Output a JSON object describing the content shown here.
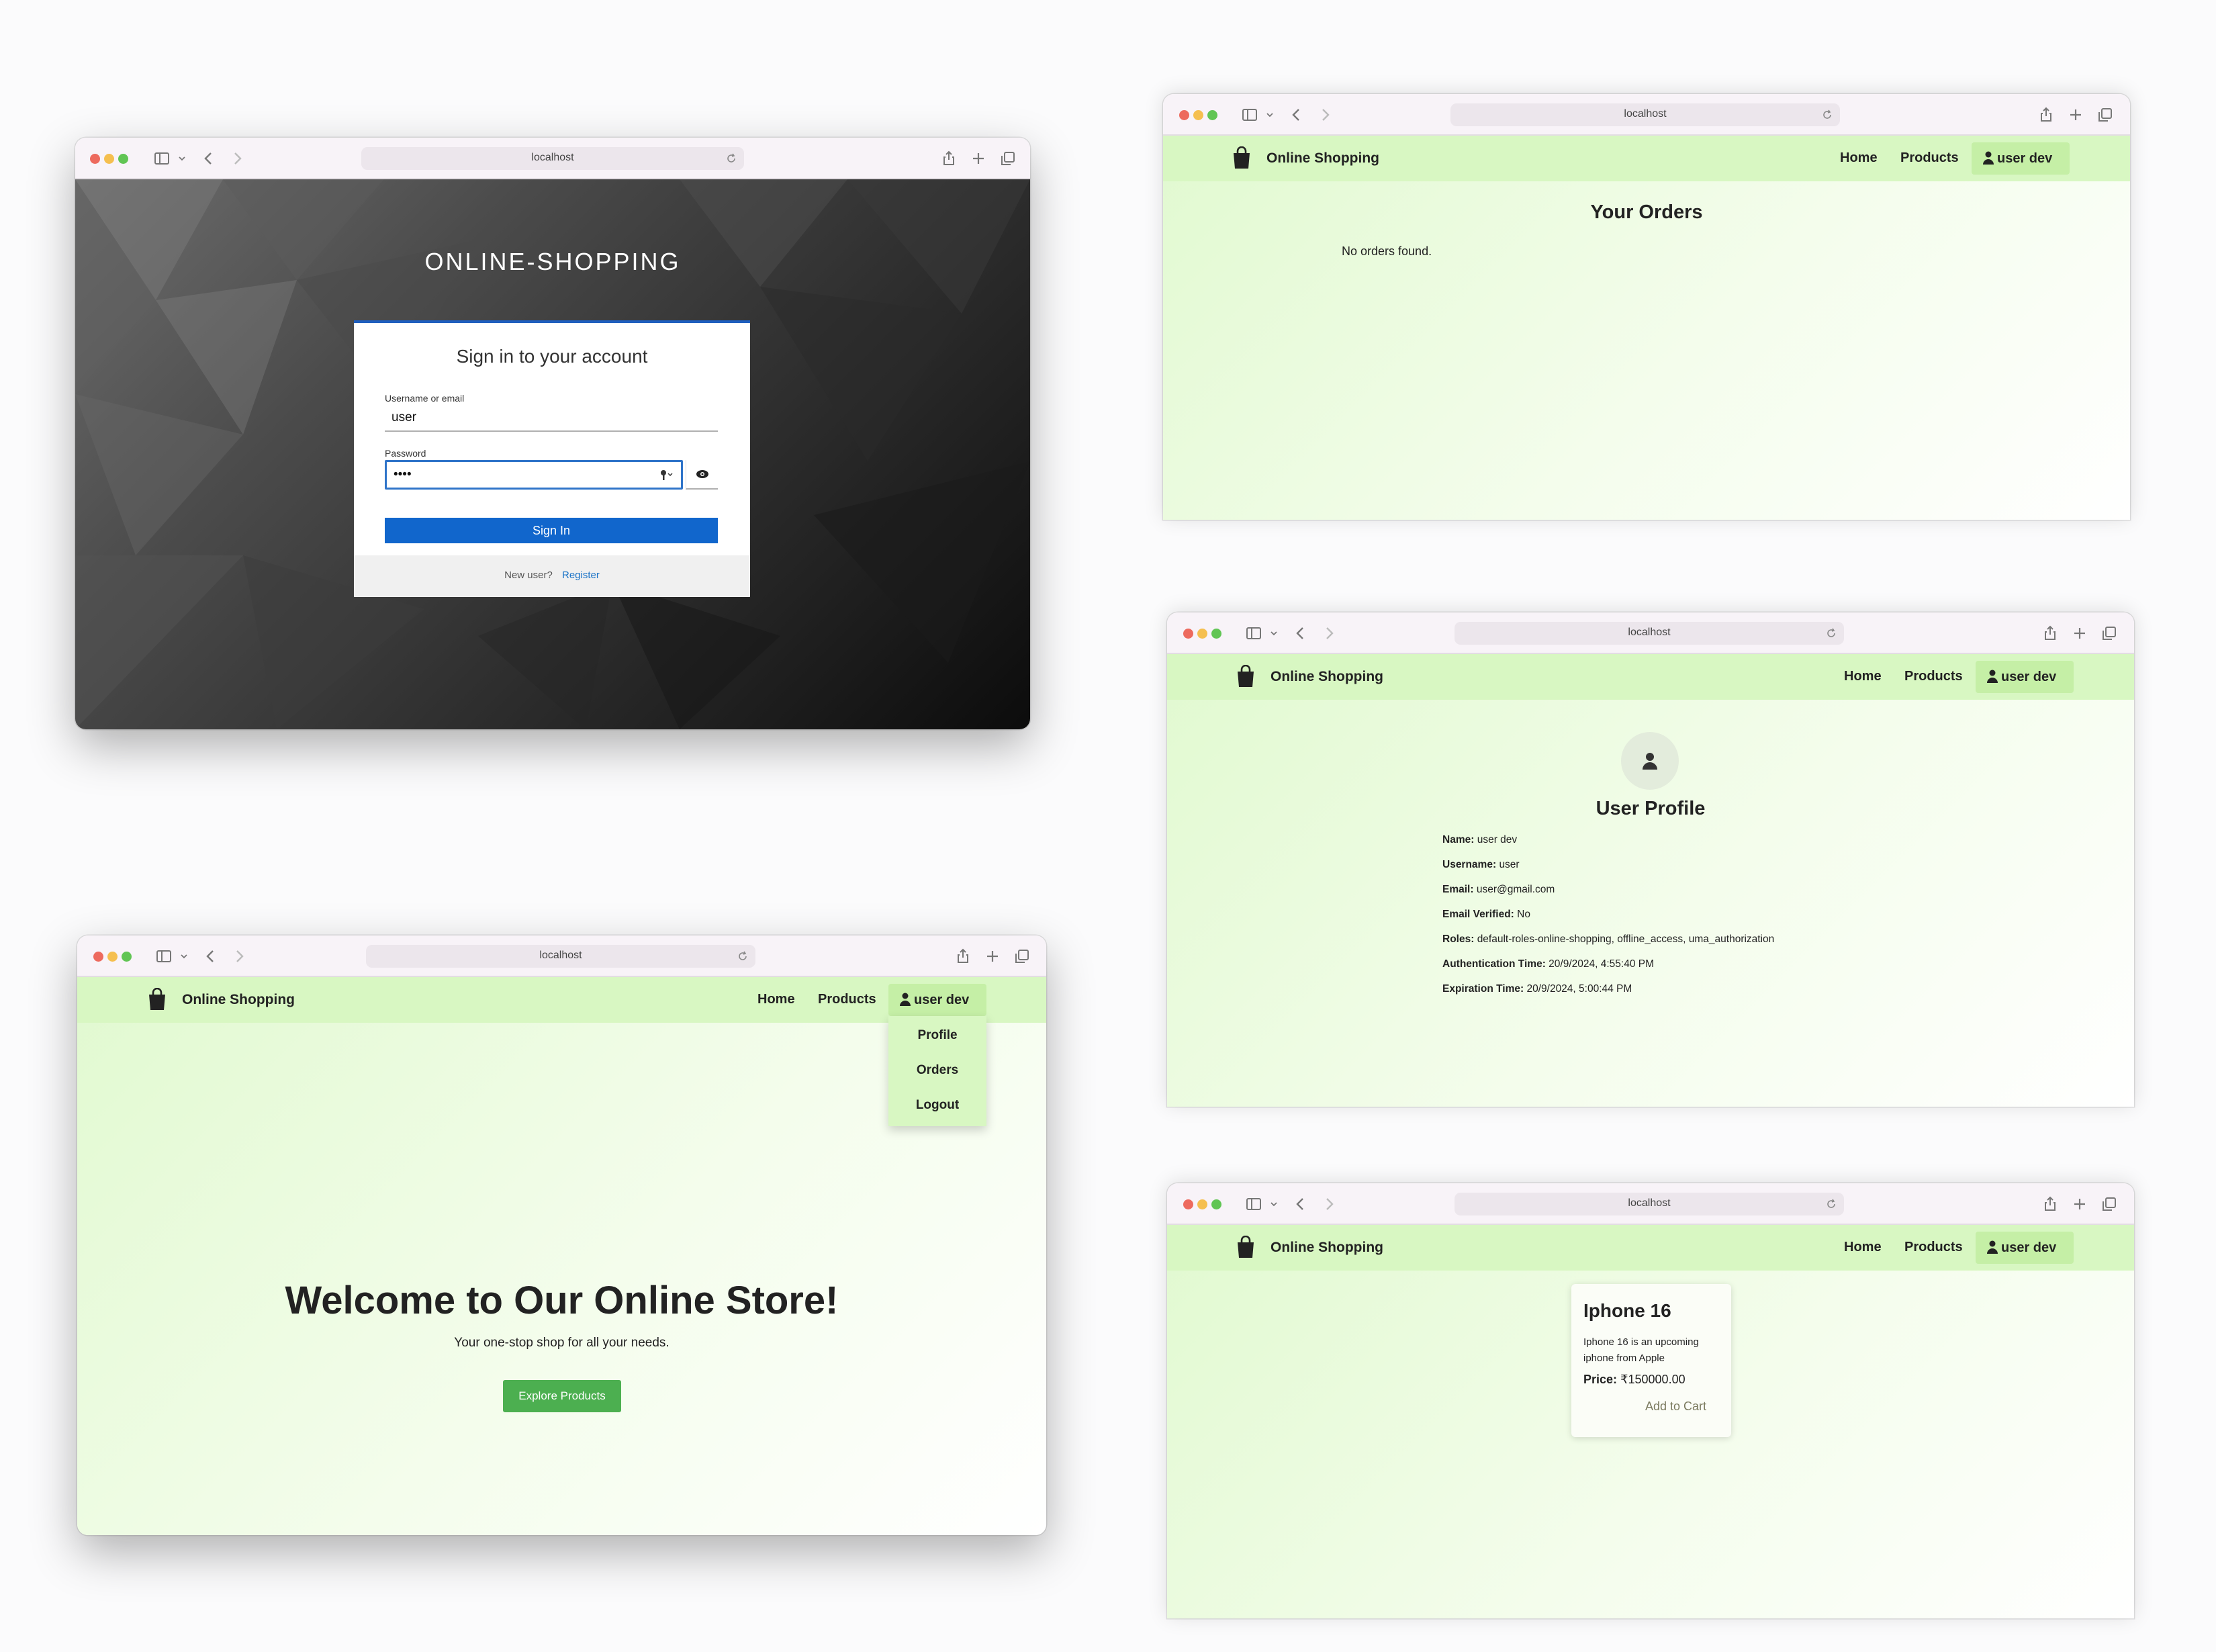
{
  "browser": {
    "url": "localhost"
  },
  "login": {
    "realm_title": "ONLINE-SHOPPING",
    "heading": "Sign in to your account",
    "username_label": "Username or email",
    "username_value": "user",
    "password_label": "Password",
    "password_value": "••••",
    "sign_in_label": "Sign In",
    "new_user_text": "New user?",
    "register_label": "Register"
  },
  "nav": {
    "brand": "Online Shopping",
    "home": "Home",
    "products": "Products",
    "user": "user dev"
  },
  "user_menu": {
    "items": [
      "Profile",
      "Orders",
      "Logout"
    ]
  },
  "home": {
    "title": "Welcome to Our Online Store!",
    "subtitle": "Your one-stop shop for all your needs.",
    "cta": "Explore Products"
  },
  "orders": {
    "title": "Your Orders",
    "empty": "No orders found."
  },
  "profile": {
    "title": "User Profile",
    "fields": [
      {
        "label": "Name:",
        "value": "user dev"
      },
      {
        "label": "Username:",
        "value": "user"
      },
      {
        "label": "Email:",
        "value": "user@gmail.com"
      },
      {
        "label": "Email Verified:",
        "value": "No"
      },
      {
        "label": "Roles:",
        "value": "default-roles-online-shopping, offline_access, uma_authorization"
      },
      {
        "label": "Authentication Time:",
        "value": "20/9/2024, 4:55:40 PM"
      },
      {
        "label": "Expiration Time:",
        "value": "20/9/2024, 5:00:44 PM"
      }
    ]
  },
  "product": {
    "name": "Iphone 16",
    "description_line1": "Iphone 16 is an upcoming",
    "description_line2": "iphone from Apple",
    "price_label": "Price:",
    "price_value": "₹150000.00",
    "add_to_cart": "Add to Cart"
  },
  "colors": {
    "nav_bg": "#d8f7c2",
    "primary_blue": "#1166cc",
    "cta_green": "#4caf50"
  }
}
